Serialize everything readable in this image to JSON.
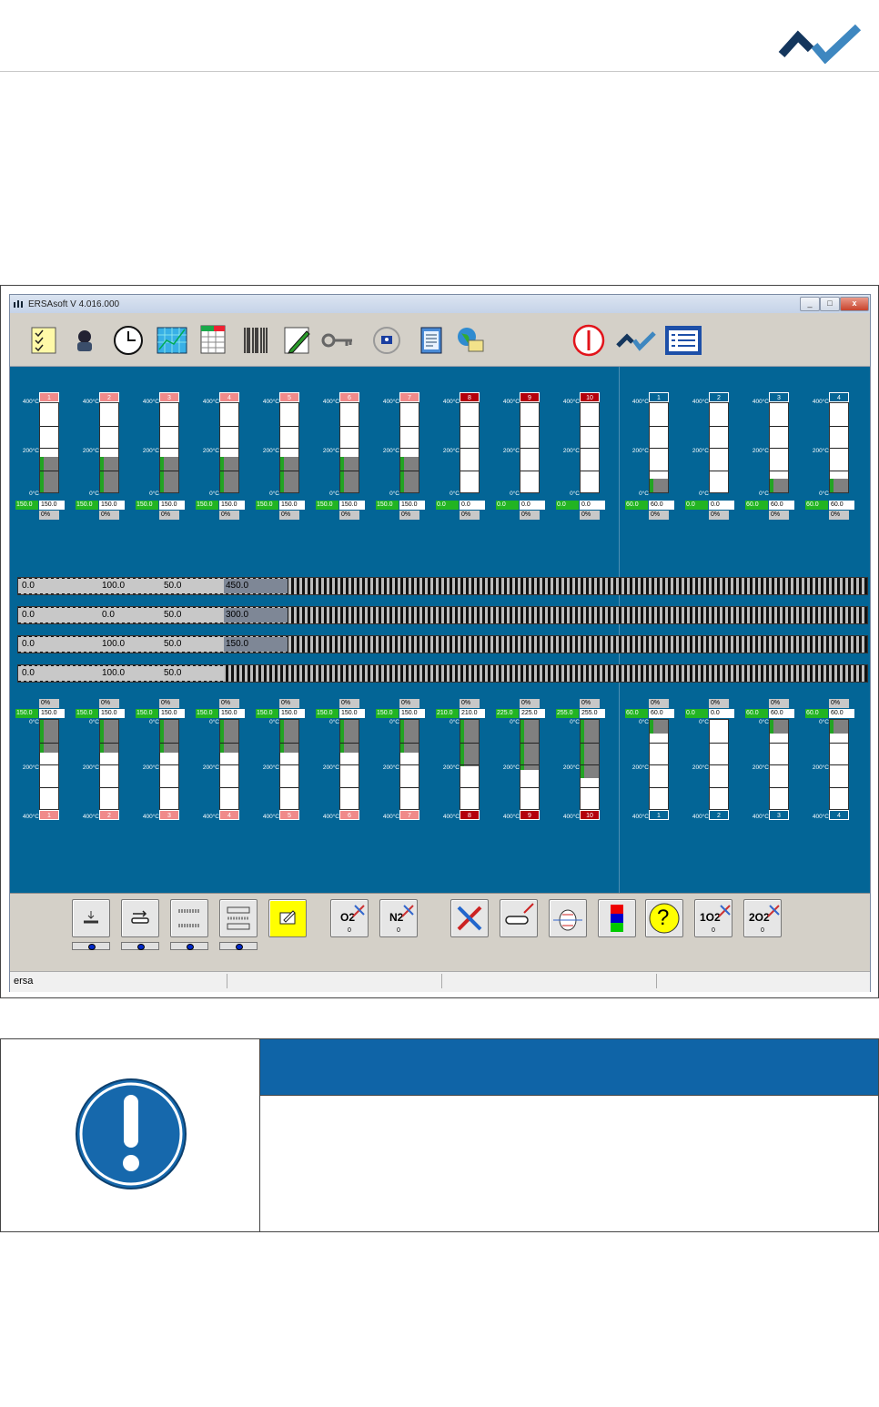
{
  "window": {
    "title": "ERSAsoft V 4.016.000",
    "buttons": [
      "_",
      "□",
      "x"
    ]
  },
  "toolbar": {
    "icons": [
      "checklist-icon",
      "user-icon",
      "clock-icon",
      "chart-icon",
      "table-icon",
      "barcode-icon",
      "pencil-icon",
      "key-icon",
      "cycle-icon",
      "notes-icon",
      "network-icon",
      "power-icon",
      "ersa-logo-icon",
      "list-icon"
    ]
  },
  "scale": {
    "top": "400°C",
    "mid": "200°C",
    "zero": "0°C"
  },
  "upper_heaters": [
    {
      "num": "1",
      "color": "pink",
      "set": "150.0",
      "actual": "150.0",
      "pct": "0%",
      "level": 0.4
    },
    {
      "num": "2",
      "color": "pink",
      "set": "150.0",
      "actual": "150.0",
      "pct": "0%",
      "level": 0.4
    },
    {
      "num": "3",
      "color": "pink",
      "set": "150.0",
      "actual": "150.0",
      "pct": "0%",
      "level": 0.4
    },
    {
      "num": "4",
      "color": "pink",
      "set": "150.0",
      "actual": "150.0",
      "pct": "0%",
      "level": 0.4
    },
    {
      "num": "5",
      "color": "pink",
      "set": "150.0",
      "actual": "150.0",
      "pct": "0%",
      "level": 0.4
    },
    {
      "num": "6",
      "color": "pink",
      "set": "150.0",
      "actual": "150.0",
      "pct": "0%",
      "level": 0.4
    },
    {
      "num": "7",
      "color": "pink",
      "set": "150.0",
      "actual": "150.0",
      "pct": "0%",
      "level": 0.4
    },
    {
      "num": "8",
      "color": "red",
      "set": "0.0",
      "actual": "0.0",
      "pct": "0%",
      "level": 0
    },
    {
      "num": "9",
      "color": "red",
      "set": "0.0",
      "actual": "0.0",
      "pct": "0%",
      "level": 0
    },
    {
      "num": "10",
      "color": "red",
      "set": "0.0",
      "actual": "0.0",
      "pct": "0%",
      "level": 0
    }
  ],
  "upper_coolers": [
    {
      "num": "1",
      "set": "60.0",
      "actual": "60.0",
      "pct": "0%",
      "level": 0.15
    },
    {
      "num": "2",
      "set": "0.0",
      "actual": "0.0",
      "pct": "0%",
      "level": 0
    },
    {
      "num": "3",
      "set": "60.0",
      "actual": "60.0",
      "pct": "0%",
      "level": 0.15
    },
    {
      "num": "4",
      "set": "60.0",
      "actual": "60.0",
      "pct": "0%",
      "level": 0.15
    }
  ],
  "conveyors": [
    {
      "a": "0.0",
      "b": "100.0",
      "c": "50.0",
      "d": "450.0"
    },
    {
      "a": "0.0",
      "b": "0.0",
      "c": "50.0",
      "d": "300.0"
    },
    {
      "a": "0.0",
      "b": "100.0",
      "c": "50.0",
      "d": "150.0"
    },
    {
      "a": "0.0",
      "b": "100.0",
      "c": "50.0",
      "d": ""
    }
  ],
  "lower_heaters": [
    {
      "num": "1",
      "color": "pink",
      "set": "150.0",
      "actual": "150.0",
      "pct": "0%",
      "level": 0.37
    },
    {
      "num": "2",
      "color": "pink",
      "set": "150.0",
      "actual": "150.0",
      "pct": "0%",
      "level": 0.37
    },
    {
      "num": "3",
      "color": "pink",
      "set": "150.0",
      "actual": "150.0",
      "pct": "0%",
      "level": 0.37
    },
    {
      "num": "4",
      "color": "pink",
      "set": "150.0",
      "actual": "150.0",
      "pct": "0%",
      "level": 0.37
    },
    {
      "num": "5",
      "color": "pink",
      "set": "150.0",
      "actual": "150.0",
      "pct": "0%",
      "level": 0.37
    },
    {
      "num": "6",
      "color": "pink",
      "set": "150.0",
      "actual": "150.0",
      "pct": "0%",
      "level": 0.37
    },
    {
      "num": "7",
      "color": "pink",
      "set": "150.0",
      "actual": "150.0",
      "pct": "0%",
      "level": 0.37
    },
    {
      "num": "8",
      "color": "red",
      "set": "210.0",
      "actual": "210.0",
      "pct": "0%",
      "level": 0.52
    },
    {
      "num": "9",
      "color": "red",
      "set": "225.0",
      "actual": "225.0",
      "pct": "0%",
      "level": 0.56
    },
    {
      "num": "10",
      "color": "red",
      "set": "255.0",
      "actual": "255.0",
      "pct": "0%",
      "level": 0.65
    }
  ],
  "lower_coolers": [
    {
      "num": "1",
      "set": "60.0",
      "actual": "60.0",
      "pct": "0%",
      "level": 0.15
    },
    {
      "num": "2",
      "set": "0.0",
      "actual": "0.0",
      "pct": "0%",
      "level": 0
    },
    {
      "num": "3",
      "set": "60.0",
      "actual": "60.0",
      "pct": "0%",
      "level": 0.15
    },
    {
      "num": "4",
      "set": "60.0",
      "actual": "60.0",
      "pct": "0%",
      "level": 0.15
    }
  ],
  "bottom_toolbar": {
    "o2_1": "O2",
    "n2": "N2",
    "o2_2": "1O2",
    "o2_3": "2O2",
    "zero": "0",
    "help": "?"
  },
  "status": {
    "user": "ersa"
  },
  "colors": {
    "panel_blue": "#036596",
    "pink": "#f08a8a",
    "red": "#b4000c",
    "green": "#22b422",
    "notice_blue": "#0f64a7"
  }
}
